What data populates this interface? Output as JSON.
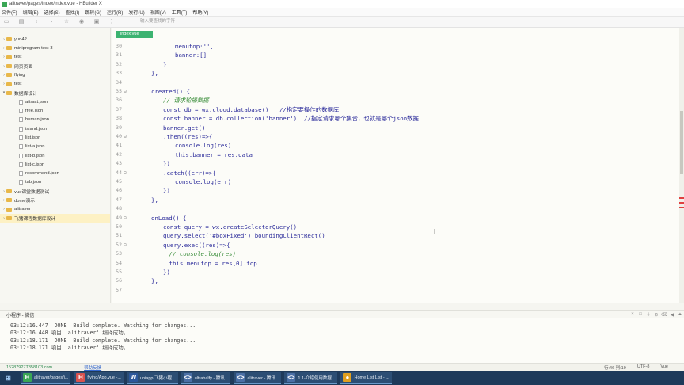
{
  "window": {
    "title": "alitraver/pages/index/index.vue - HBuilder X"
  },
  "menu": [
    "文件(F)",
    "编辑(E)",
    "选择(S)",
    "查找(I)",
    "跳转(G)",
    "运行(R)",
    "发行(U)",
    "视图(V)",
    "工具(T)",
    "帮助(Y)"
  ],
  "toolbar": {
    "icons": [
      "new-file-icon",
      "save-icon",
      "back-icon",
      "forward-icon",
      "star-icon",
      "run-icon",
      "preview-icon",
      "more-icon"
    ],
    "search_placeholder": "输入要查找的字符"
  },
  "sidebar": {
    "items": [
      {
        "label": "yun42",
        "type": "folder",
        "indent": 0,
        "expanded": false
      },
      {
        "label": "miniprogram-test-3",
        "type": "folder",
        "indent": 0,
        "expanded": false
      },
      {
        "label": "test",
        "type": "folder",
        "indent": 0,
        "expanded": false
      },
      {
        "label": "网页页面",
        "type": "folder",
        "indent": 0,
        "expanded": false
      },
      {
        "label": "flying",
        "type": "folder",
        "indent": 0,
        "expanded": false
      },
      {
        "label": "test",
        "type": "folder",
        "indent": 0,
        "expanded": false
      },
      {
        "label": "数据库设计",
        "type": "folder",
        "indent": 0,
        "expanded": true
      },
      {
        "label": "attract.json",
        "type": "file",
        "indent": 1
      },
      {
        "label": "free.json",
        "type": "file",
        "indent": 1
      },
      {
        "label": "human.json",
        "type": "file",
        "indent": 1
      },
      {
        "label": "island.json",
        "type": "file",
        "indent": 1
      },
      {
        "label": "list.json",
        "type": "file",
        "indent": 1
      },
      {
        "label": "list-a.json",
        "type": "file",
        "indent": 1
      },
      {
        "label": "list-b.json",
        "type": "file",
        "indent": 1
      },
      {
        "label": "list-c.json",
        "type": "file",
        "indent": 1
      },
      {
        "label": "recommend.json",
        "type": "file",
        "indent": 1
      },
      {
        "label": "tab.json",
        "type": "file",
        "indent": 1
      },
      {
        "label": "vue课堂数据测试",
        "type": "folder",
        "indent": 0,
        "expanded": false
      },
      {
        "label": "dome演示",
        "type": "folder",
        "indent": 0,
        "expanded": false
      },
      {
        "label": "alitraver",
        "type": "folder",
        "indent": 0,
        "expanded": false
      },
      {
        "label": "飞猪课程数据库设计",
        "type": "folder",
        "indent": 0,
        "expanded": false,
        "selected": true
      }
    ]
  },
  "editor": {
    "tab": "index.vue",
    "lines": [
      {
        "n": "30",
        "fold": "",
        "indent": 8,
        "text": "menutop:'',",
        "cls": ""
      },
      {
        "n": "31",
        "fold": "",
        "indent": 8,
        "text": "banner:[]",
        "cls": ""
      },
      {
        "n": "32",
        "fold": "",
        "indent": 6,
        "text": "}",
        "cls": ""
      },
      {
        "n": "33",
        "fold": "",
        "indent": 4,
        "text": "},",
        "cls": ""
      },
      {
        "n": "34",
        "fold": "",
        "indent": 0,
        "text": "",
        "cls": ""
      },
      {
        "n": "35",
        "fold": "⊟",
        "indent": 4,
        "text": "created() {",
        "cls": ""
      },
      {
        "n": "36",
        "fold": "",
        "indent": 6,
        "text": "// 请求轮播数据",
        "cls": "c-comment"
      },
      {
        "n": "37",
        "fold": "",
        "indent": 6,
        "text": "const db = wx.cloud.database()   //指定要操作的数据库",
        "cls": ""
      },
      {
        "n": "38",
        "fold": "",
        "indent": 6,
        "text": "const banner = db.collection('banner')  //指定请求哪个集合，也就是哪个json数据",
        "cls": ""
      },
      {
        "n": "39",
        "fold": "",
        "indent": 6,
        "text": "banner.get()",
        "cls": ""
      },
      {
        "n": "40",
        "fold": "⊟",
        "indent": 6,
        "text": ".then((res)=>{",
        "cls": ""
      },
      {
        "n": "41",
        "fold": "",
        "indent": 8,
        "text": "console.log(res)",
        "cls": ""
      },
      {
        "n": "42",
        "fold": "",
        "indent": 8,
        "text": "this.banner = res.data",
        "cls": ""
      },
      {
        "n": "43",
        "fold": "",
        "indent": 6,
        "text": "})",
        "cls": ""
      },
      {
        "n": "44",
        "fold": "⊟",
        "indent": 6,
        "text": ".catch((err)=>{",
        "cls": ""
      },
      {
        "n": "45",
        "fold": "",
        "indent": 8,
        "text": "console.log(err)",
        "cls": ""
      },
      {
        "n": "46",
        "fold": "",
        "indent": 6,
        "text": "})",
        "cls": ""
      },
      {
        "n": "47",
        "fold": "",
        "indent": 4,
        "text": "},",
        "cls": ""
      },
      {
        "n": "48",
        "fold": "",
        "indent": 0,
        "text": "",
        "cls": ""
      },
      {
        "n": "49",
        "fold": "⊟",
        "indent": 4,
        "text": "onLoad() {",
        "cls": ""
      },
      {
        "n": "50",
        "fold": "",
        "indent": 6,
        "text": "const query = wx.createSelectorQuery()",
        "cls": ""
      },
      {
        "n": "51",
        "fold": "",
        "indent": 6,
        "text": "query.select('#boxFixed').boundingClientRect()",
        "cls": ""
      },
      {
        "n": "52",
        "fold": "⊟",
        "indent": 6,
        "text": "query.exec((res)=>{",
        "cls": ""
      },
      {
        "n": "53",
        "fold": "",
        "indent": 7,
        "text": "// console.log(res)",
        "cls": "c-comment"
      },
      {
        "n": "54",
        "fold": "",
        "indent": 7,
        "text": "this.menutop = res[0].top",
        "cls": ""
      },
      {
        "n": "55",
        "fold": "",
        "indent": 6,
        "text": "})",
        "cls": ""
      },
      {
        "n": "56",
        "fold": "",
        "indent": 4,
        "text": "},",
        "cls": ""
      },
      {
        "n": "57",
        "fold": "",
        "indent": 0,
        "text": "",
        "cls": ""
      }
    ]
  },
  "console": {
    "tab": "小程序 - 微信",
    "lines": [
      "03:12:16.447  DONE  Build complete. Watching for changes...",
      "03:12:16.448 项目 'alitraver' 编译成功。",
      "03:12:18.171  DONE  Build complete. Watching for changes...",
      "03:12:18.171 项目 'alitraver' 编译成功。"
    ],
    "controls": [
      "×",
      "□",
      "⇩",
      "⊘",
      "⌫",
      "◀",
      "▲"
    ]
  },
  "status": {
    "user": "15287927T358103.com",
    "link": "帮助反馈",
    "position": "行:46  列:19",
    "encoding": "UTF-8",
    "language": "Vue"
  },
  "taskbar": {
    "items": [
      {
        "label": "alitraver/pages/i...",
        "icon": "H",
        "color": "#3aa655"
      },
      {
        "label": "flying/App.vue -...",
        "icon": "H",
        "color": "#d9534f"
      },
      {
        "label": "uniapp 飞猪小程...",
        "icon": "W",
        "color": "#2b579a"
      },
      {
        "label": "ultrabalfy - 腾讯...",
        "icon": "<>",
        "color": "#4a6fa5"
      },
      {
        "label": "alitraver - 腾讯...",
        "icon": "<>",
        "color": "#4a6fa5"
      },
      {
        "label": "1.1-介绍使用数据...",
        "icon": "<>",
        "color": "#4a6fa5"
      },
      {
        "label": "Home List List - ...",
        "icon": "●",
        "color": "#e0a020"
      }
    ]
  }
}
